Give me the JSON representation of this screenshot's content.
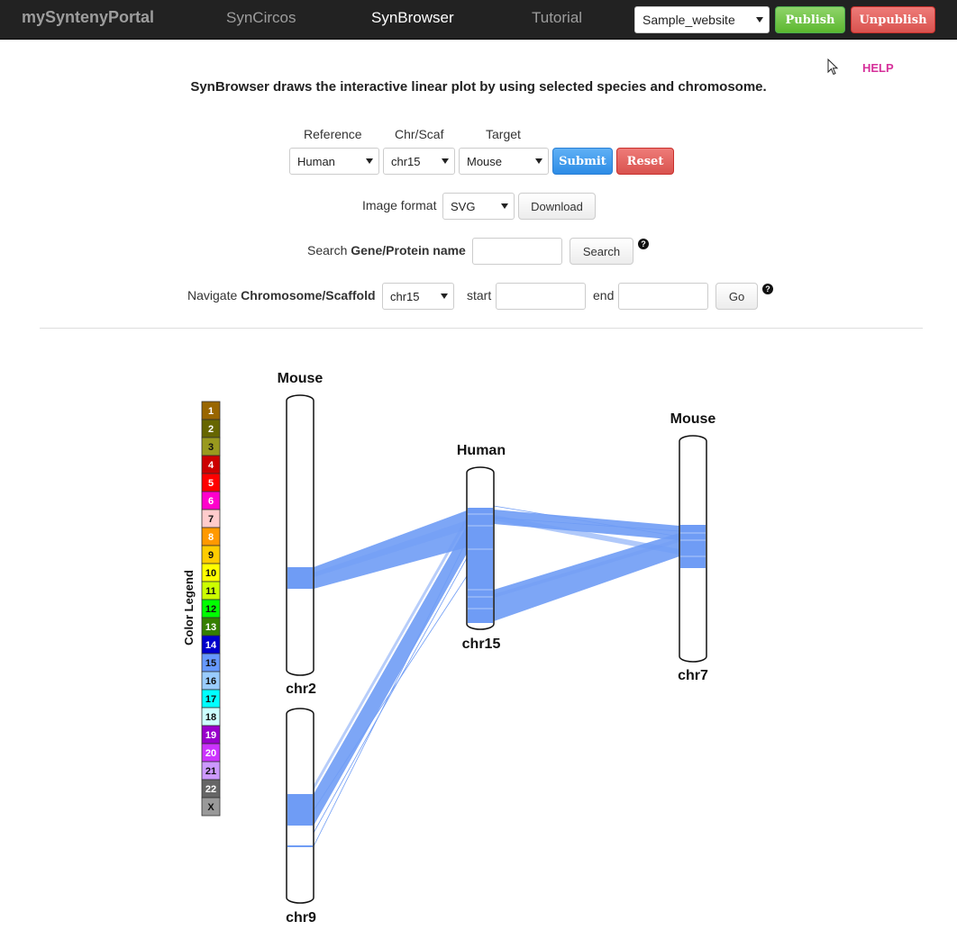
{
  "navbar": {
    "brand": "mySyntenyPortal",
    "links": [
      "SynCircos",
      "SynBrowser",
      "Tutorial"
    ],
    "active": "SynBrowser",
    "site_select": "Sample_website",
    "publish_label": "Publish",
    "unpublish_label": "Unpublish"
  },
  "help_label": "HELP",
  "headline": "SynBrowser draws the interactive linear plot by using selected species and chromosome.",
  "form": {
    "reference_label": "Reference",
    "chr_label": "Chr/Scaf",
    "target_label": "Target",
    "reference_value": "Human",
    "chr_value": "chr15",
    "target_value": "Mouse",
    "submit_label": "Submit",
    "reset_label": "Reset",
    "image_format_label": "Image format",
    "image_format_value": "SVG",
    "download_label": "Download",
    "search_prefix": "Search ",
    "search_bold": "Gene/Protein name",
    "search_value": "",
    "search_button": "Search",
    "navigate_prefix": "Navigate ",
    "navigate_bold": "Chromosome/Scaffold",
    "navigate_value": "chr15",
    "start_label": "start",
    "start_value": "",
    "end_label": "end",
    "end_value": "",
    "go_label": "Go",
    "help_mark": "?"
  },
  "plot": {
    "legend_title": "Color Legend",
    "legend": [
      {
        "label": "1",
        "color": "#996600"
      },
      {
        "label": "2",
        "color": "#666600"
      },
      {
        "label": "3",
        "color": "#99991e"
      },
      {
        "label": "4",
        "color": "#cc0000"
      },
      {
        "label": "5",
        "color": "#ff0000"
      },
      {
        "label": "6",
        "color": "#ff00cc"
      },
      {
        "label": "7",
        "color": "#ffcccc"
      },
      {
        "label": "8",
        "color": "#ff9900"
      },
      {
        "label": "9",
        "color": "#ffcc00"
      },
      {
        "label": "10",
        "color": "#ffff00"
      },
      {
        "label": "11",
        "color": "#ccff00"
      },
      {
        "label": "12",
        "color": "#00ff00"
      },
      {
        "label": "13",
        "color": "#358000"
      },
      {
        "label": "14",
        "color": "#0000cc"
      },
      {
        "label": "15",
        "color": "#6699ff"
      },
      {
        "label": "16",
        "color": "#99ccff"
      },
      {
        "label": "17",
        "color": "#00ffff"
      },
      {
        "label": "18",
        "color": "#ccffff"
      },
      {
        "label": "19",
        "color": "#9900cc"
      },
      {
        "label": "20",
        "color": "#cc33ff"
      },
      {
        "label": "21",
        "color": "#cc99ff"
      },
      {
        "label": "22",
        "color": "#666666"
      },
      {
        "label": "X",
        "color": "#999999"
      }
    ],
    "chromosomes": {
      "mouse_chr2": {
        "species": "Mouse",
        "name": "chr2"
      },
      "mouse_chr9": {
        "name": "chr9"
      },
      "human_chr15": {
        "species": "Human",
        "name": "chr15"
      },
      "mouse_chr7": {
        "species": "Mouse",
        "name": "chr7"
      }
    },
    "link_color": "#6f9cf5"
  }
}
